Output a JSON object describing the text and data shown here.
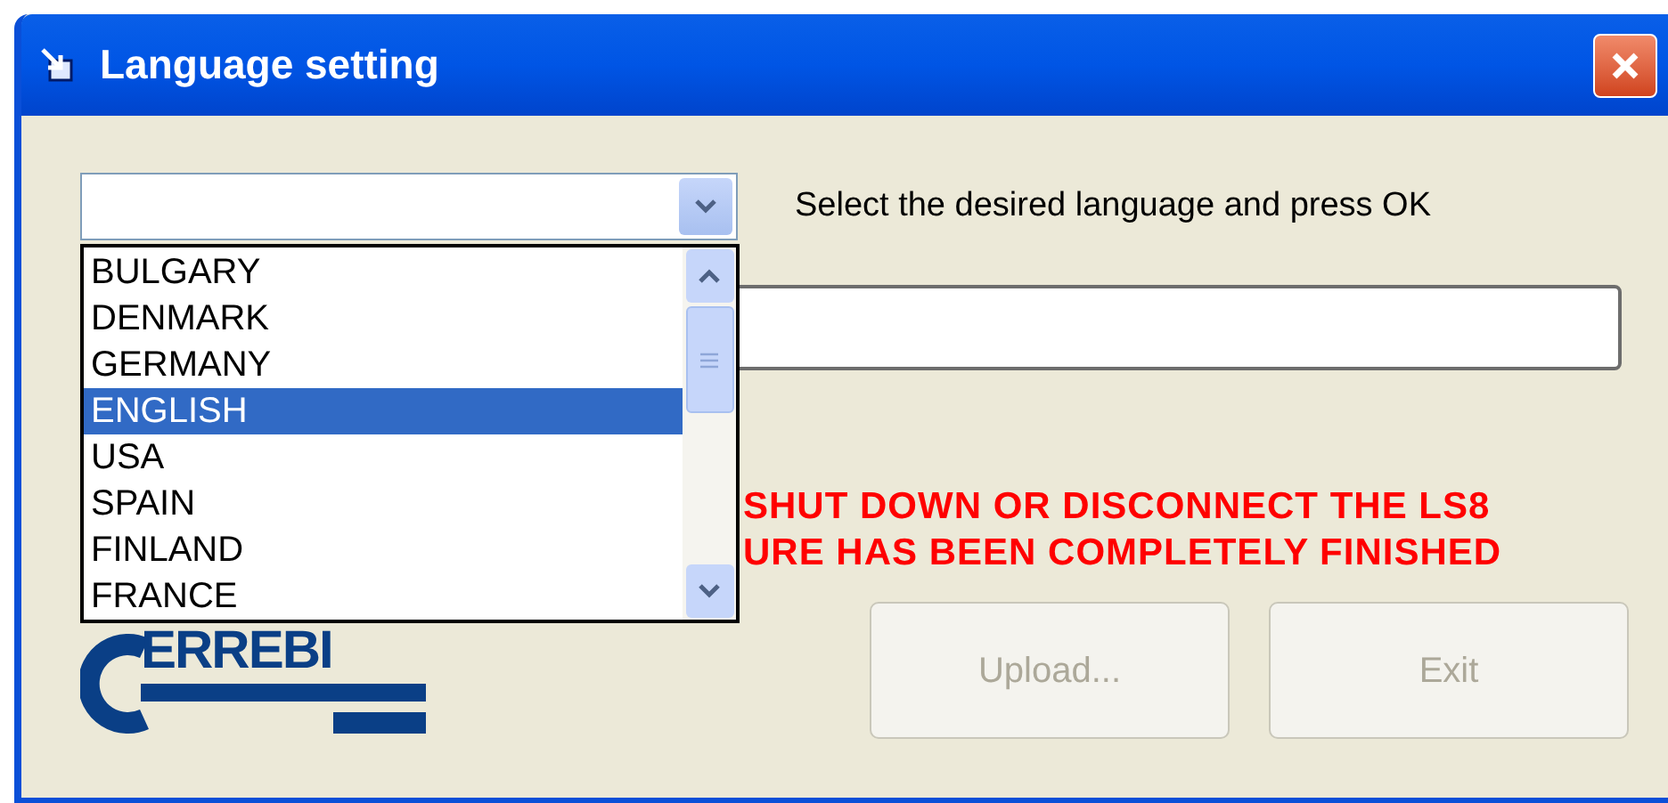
{
  "window": {
    "title": "Language setting"
  },
  "instruction": "Select the desired language and press OK",
  "language_list": [
    {
      "label": "BULGARY",
      "selected": false
    },
    {
      "label": "DENMARK",
      "selected": false
    },
    {
      "label": "GERMANY",
      "selected": false
    },
    {
      "label": "ENGLISH",
      "selected": true
    },
    {
      "label": "USA",
      "selected": false
    },
    {
      "label": "SPAIN",
      "selected": false
    },
    {
      "label": "FINLAND",
      "selected": false
    },
    {
      "label": "FRANCE",
      "selected": false
    }
  ],
  "warning": [
    "SHUT DOWN OR DISCONNECT THE LS8",
    "URE HAS BEEN COMPLETELY FINISHED"
  ],
  "logo": {
    "text": "ERREBI"
  },
  "buttons": [
    {
      "label": "Upload...",
      "disabled": true
    },
    {
      "label": "Exit",
      "disabled": true
    }
  ]
}
